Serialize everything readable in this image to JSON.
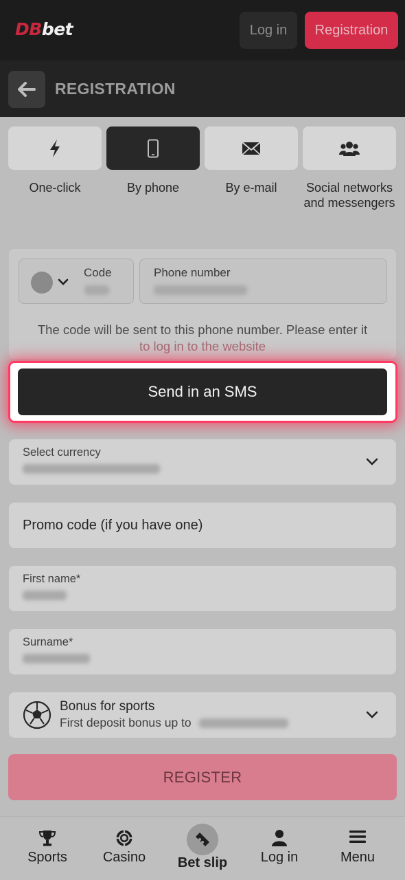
{
  "header": {
    "logo_db": "DB",
    "logo_bet": "bet",
    "login_label": "Log in",
    "registration_label": "Registration"
  },
  "subheader": {
    "title": "REGISTRATION"
  },
  "methods": [
    {
      "label": "One-click",
      "icon": "lightning-icon",
      "active": false
    },
    {
      "label": "By phone",
      "icon": "smartphone-icon",
      "active": true
    },
    {
      "label": "By e-mail",
      "icon": "envelope-icon",
      "active": false
    },
    {
      "label": "Social networks and messengers",
      "icon": "users-icon",
      "active": false
    }
  ],
  "phone_form": {
    "code_label": "Code",
    "phone_label": "Phone number",
    "hint_text": "The code will be sent to this phone number. Please enter it",
    "hint_link": "to log in to the website",
    "send_sms_label": "Send in an SMS"
  },
  "fields": {
    "currency_label": "Select currency",
    "promo_placeholder": "Promo code (if you have one)",
    "first_name_label": "First name*",
    "surname_label": "Surname*"
  },
  "bonus": {
    "title": "Bonus for sports",
    "subtitle": "First deposit bonus up to"
  },
  "register_label": "REGISTER",
  "bottom_nav": [
    {
      "label": "Sports",
      "icon": "trophy-icon"
    },
    {
      "label": "Casino",
      "icon": "casino-chip-icon"
    },
    {
      "label": "Bet slip",
      "icon": "ticket-icon"
    },
    {
      "label": "Log in",
      "icon": "user-icon"
    },
    {
      "label": "Menu",
      "icon": "hamburger-icon"
    }
  ],
  "colors": {
    "brand_red": "#d42d4a",
    "highlight": "#ff3b63"
  }
}
